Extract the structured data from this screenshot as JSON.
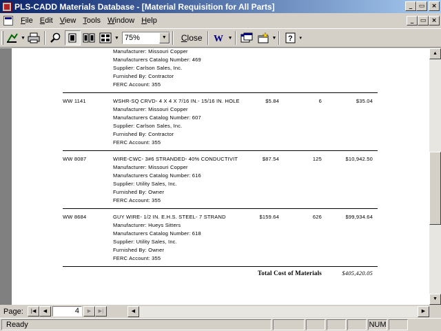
{
  "window": {
    "title": "PLS-CADD Materials Database - [Material Requisition for All Parts]",
    "min_glyph": "_",
    "max_glyph": "▭",
    "close_glyph": "×"
  },
  "menu": {
    "items": [
      {
        "label": "File",
        "accel": "F",
        "rest": "ile"
      },
      {
        "label": "Edit",
        "accel": "E",
        "rest": "dit"
      },
      {
        "label": "View",
        "accel": "V",
        "rest": "iew"
      },
      {
        "label": "Tools",
        "accel": "T",
        "rest": "ools"
      },
      {
        "label": "Window",
        "accel": "W",
        "rest": "indow"
      },
      {
        "label": "Help",
        "accel": "H",
        "rest": "elp"
      }
    ]
  },
  "toolbar": {
    "zoom_value": "75%",
    "close_accel": "C",
    "close_rest": "lose"
  },
  "report": {
    "top_partial": {
      "lines": [
        "Manufacturer: Missouri Copper",
        "Manufacturers Catalog Number: 469",
        "Supplier: Carlson Sales, Inc.",
        "Furnished By: Contractor",
        "FERC Account: 355"
      ]
    },
    "items": [
      {
        "stock": "WW 1141",
        "description": "WSHR-SQ CRVD- 4 X 4 X 7/16 IN.- 15/16 IN. HOLE",
        "unit_cost": "$5.84",
        "qty": "6",
        "total": "$35.04",
        "lines": [
          "Manufacturer: Missouri Copper",
          "Manufacturers Catalog Number: 607",
          "Supplier: Carlson Sales, Inc.",
          "Furnished By: Contractor",
          "FERC Account: 355"
        ]
      },
      {
        "stock": "WW 8087",
        "description": "WIRE-CWC- 3#6 STRANDED- 40% CONDUCTIVIT",
        "unit_cost": "$87.54",
        "qty": "125",
        "total": "$10,942.50",
        "lines": [
          "Manufacturer: Missouri Copper",
          "Manufacturers Catalog Number: 616",
          "Supplier: Utility Sales, Inc.",
          "Furnished By: Owner",
          "FERC Account: 355"
        ]
      },
      {
        "stock": "WW 8684",
        "description": "GUY WIRE- 1/2 IN. E.H.S. STEEL- 7 STRAND",
        "unit_cost": "$159.64",
        "qty": "626",
        "total": "$99,934.64",
        "lines": [
          "Manufacturer: Hueys Sitters",
          "Manufacturers Catalog Number: 618",
          "Supplier: Utility Sales, Inc.",
          "Furnished By: Owner",
          "FERC Account: 355"
        ]
      }
    ],
    "total_label": "Total Cost of Materials",
    "total_value": "$405,420.05"
  },
  "nav": {
    "page_label": "Page:",
    "current_page": "4"
  },
  "status": {
    "text": "Ready",
    "num": "NUM"
  }
}
